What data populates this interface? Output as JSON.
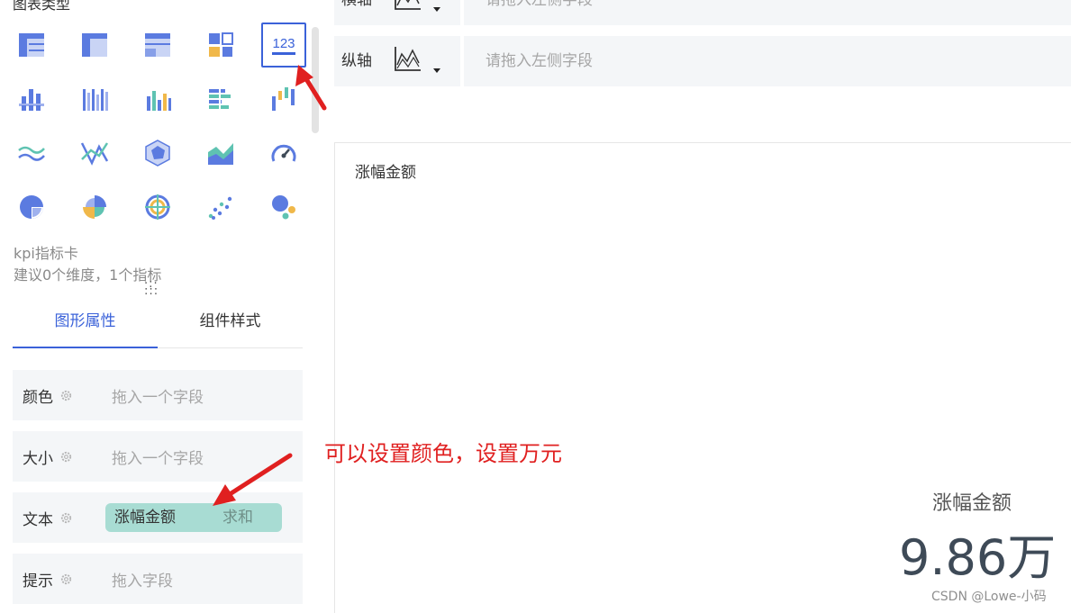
{
  "left_panel": {
    "chart_types_title": "图表类型",
    "chart_types": [
      {
        "icon": "table-icon",
        "selected": false
      },
      {
        "icon": "cross-table-icon",
        "selected": false
      },
      {
        "icon": "detail-table-icon",
        "selected": false
      },
      {
        "icon": "block-chart-icon",
        "selected": false
      },
      {
        "icon": "kpi-card-icon",
        "selected": true,
        "text": "123"
      },
      {
        "icon": "stacked-bar-icon",
        "selected": false
      },
      {
        "icon": "grouped-bar-icon",
        "selected": false
      },
      {
        "icon": "column-chart-icon",
        "selected": false
      },
      {
        "icon": "horizontal-bar-icon",
        "selected": false
      },
      {
        "icon": "waterfall-icon",
        "selected": false
      },
      {
        "icon": "line-chart-icon",
        "selected": false
      },
      {
        "icon": "combo-chart-icon",
        "selected": false
      },
      {
        "icon": "radar-chart-icon",
        "selected": false
      },
      {
        "icon": "area-chart-icon",
        "selected": false
      },
      {
        "icon": "gauge-icon",
        "selected": false
      },
      {
        "icon": "pie-chart-icon",
        "selected": false
      },
      {
        "icon": "rose-chart-icon",
        "selected": false
      },
      {
        "icon": "ring-chart-icon",
        "selected": false
      },
      {
        "icon": "scatter-icon",
        "selected": false
      },
      {
        "icon": "bubble-icon",
        "selected": false
      }
    ],
    "selected_type_name": "kpi指标卡",
    "selected_type_hint": "建议0个维度，1个指标",
    "tabs": [
      {
        "label": "图形属性",
        "active": true
      },
      {
        "label": "组件样式",
        "active": false
      }
    ],
    "properties": {
      "color": {
        "label": "颜色",
        "placeholder": "拖入一个字段"
      },
      "size": {
        "label": "大小",
        "placeholder": "拖入一个字段"
      },
      "text": {
        "label": "文本",
        "field": "涨幅金额",
        "aggregation": "求和"
      },
      "tooltip": {
        "label": "提示",
        "placeholder": "拖入字段"
      }
    }
  },
  "axes": {
    "x": {
      "label": "横轴",
      "placeholder": "请拖入左侧字段"
    },
    "y": {
      "label": "纵轴",
      "placeholder": "请拖入左侧字段"
    }
  },
  "preview": {
    "title": "涨幅金额",
    "kpi_label": "涨幅金额",
    "kpi_value": "9.86万"
  },
  "annotation": "可以设置颜色，设置万元",
  "watermark": "CSDN @Lowe-小码",
  "colors": {
    "accent": "#3b62d9",
    "pill": "#a8dcd3",
    "annotation": "#e02020",
    "icon_blue": "#5b7be0",
    "icon_teal": "#5fc3b2",
    "icon_yellow": "#f0b84a"
  }
}
